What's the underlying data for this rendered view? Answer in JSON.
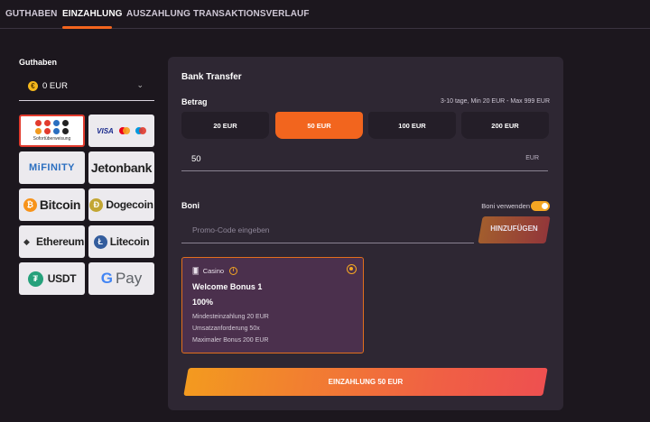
{
  "tabs": [
    {
      "label": "GUTHABEN",
      "active": false
    },
    {
      "label": "EINZAHLUNG",
      "active": true
    },
    {
      "label": "AUSZAHLUNG",
      "active": false
    },
    {
      "label": "TRANSAKTIONSVERLAUF",
      "active": false
    }
  ],
  "sidebar": {
    "title": "Guthaben",
    "currency_icon": "€",
    "balance": "0 EUR",
    "methods": [
      {
        "name": "sofort",
        "label": "Sofortüberweisung",
        "selected": true
      },
      {
        "name": "cards",
        "label": "VISA"
      },
      {
        "name": "mifinity",
        "label": "MiFINITY"
      },
      {
        "name": "jetonbank",
        "label": "Jetonbank"
      },
      {
        "name": "bitcoin",
        "label": "Bitcoin",
        "icon": "₿"
      },
      {
        "name": "dogecoin",
        "label": "Dogecoin",
        "icon": "Ð"
      },
      {
        "name": "ethereum",
        "label": "Ethereum",
        "icon": "◆"
      },
      {
        "name": "litecoin",
        "label": "Litecoin",
        "icon": "Ł"
      },
      {
        "name": "usdt",
        "label": "USDT",
        "icon": "₮"
      },
      {
        "name": "gpay",
        "g": "G",
        "label": "Pay"
      }
    ]
  },
  "panel": {
    "title": "Bank Transfer",
    "amount_label": "Betrag",
    "range_hint": "3-10 tage, Min 20 EUR - Max 999 EUR",
    "amounts": [
      "20 EUR",
      "50 EUR",
      "100 EUR",
      "200 EUR"
    ],
    "selected_amount_index": 1,
    "amount_value": "50",
    "amount_unit": "EUR",
    "boni_label": "Boni",
    "boni_toggle_label": "Boni verwenden",
    "boni_enabled": true,
    "promo_placeholder": "Promo-Code eingeben",
    "promo_button": "HINZUFÜGEN",
    "bonus": {
      "category": "Casino",
      "info_icon": "i",
      "title": "Welcome Bonus 1",
      "percent": "100%",
      "lines": [
        "Mindesteinzahlung 20 EUR",
        "Umsatzanforderung 50x",
        "Maximaler Bonus 200 EUR"
      ]
    },
    "submit": "EINZAHLUNG 50 EUR"
  },
  "colors": {
    "accent": "#f2651e",
    "background": "#1c171e",
    "panel": "#2e2733",
    "bonus_card": "#4b304d",
    "toggle": "#f5a623"
  }
}
